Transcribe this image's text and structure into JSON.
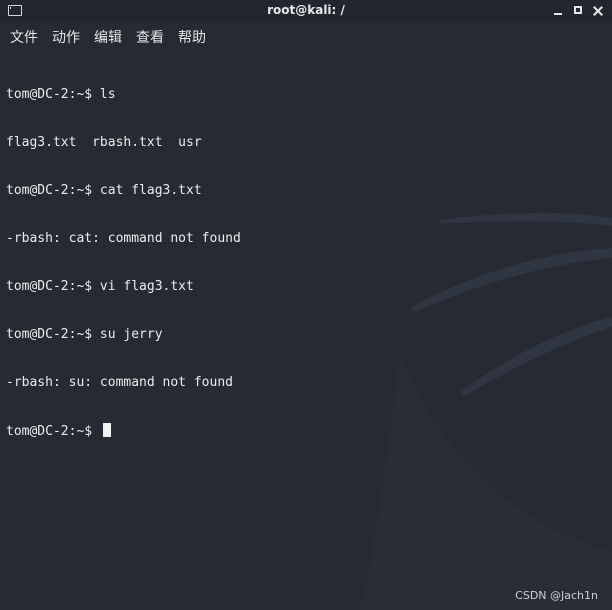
{
  "window": {
    "title": "root@kali: /"
  },
  "menu": {
    "items": [
      {
        "label": "文件"
      },
      {
        "label": "动作"
      },
      {
        "label": "编辑"
      },
      {
        "label": "查看"
      },
      {
        "label": "帮助"
      }
    ]
  },
  "terminal": {
    "lines": [
      "tom@DC-2:~$ ls",
      "flag3.txt  rbash.txt  usr",
      "tom@DC-2:~$ cat flag3.txt",
      "-rbash: cat: command not found",
      "tom@DC-2:~$ vi flag3.txt",
      "tom@DC-2:~$ su jerry",
      "-rbash: su: command not found",
      "tom@DC-2:~$ "
    ]
  },
  "watermark": "CSDN @Jach1n",
  "colors": {
    "background": "#252a33",
    "titlebar": "#22262e",
    "text": "#ececec",
    "logo": "#2f3541"
  },
  "icons": {
    "app": "terminal-icon",
    "minimize": "minimize-icon",
    "maximize": "maximize-icon",
    "close": "close-icon",
    "background": "kali-dragon-logo"
  }
}
